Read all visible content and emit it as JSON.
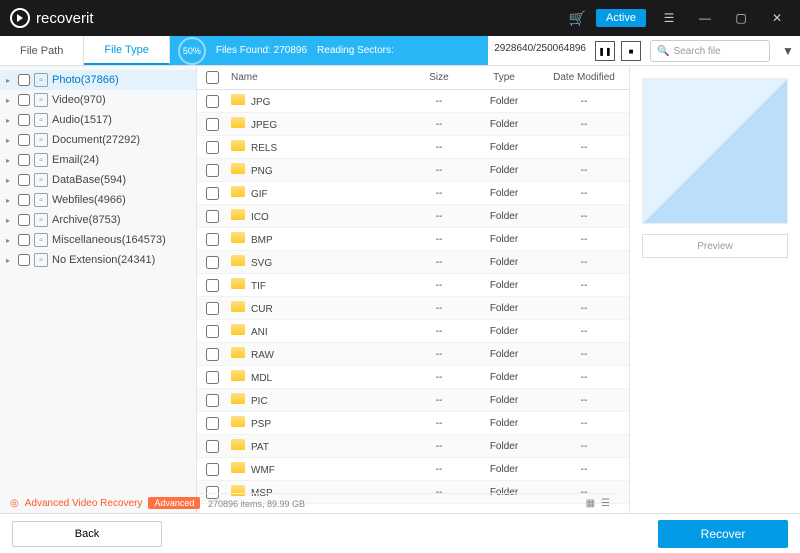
{
  "app": {
    "name": "recoverit",
    "active_btn": "Active"
  },
  "tabs": {
    "path": "File Path",
    "type": "File Type"
  },
  "scan": {
    "percent": "50%",
    "found_label": "Files Found:",
    "found_count": "270896",
    "reading_label": "Reading Sectors:",
    "sectors": "2928640/250064896"
  },
  "search": {
    "placeholder": "Search file"
  },
  "sidebar": [
    {
      "label": "Photo(37866)",
      "sel": true
    },
    {
      "label": "Video(970)"
    },
    {
      "label": "Audio(1517)"
    },
    {
      "label": "Document(27292)"
    },
    {
      "label": "Email(24)"
    },
    {
      "label": "DataBase(594)"
    },
    {
      "label": "Webfiles(4966)"
    },
    {
      "label": "Archive(8753)"
    },
    {
      "label": "Miscellaneous(164573)"
    },
    {
      "label": "No Extension(24341)"
    }
  ],
  "columns": {
    "name": "Name",
    "size": "Size",
    "type": "Type",
    "date": "Date Modified"
  },
  "rows": [
    {
      "name": "JPG",
      "size": "--",
      "type": "Folder",
      "date": "--"
    },
    {
      "name": "JPEG",
      "size": "--",
      "type": "Folder",
      "date": "--"
    },
    {
      "name": "RELS",
      "size": "--",
      "type": "Folder",
      "date": "--"
    },
    {
      "name": "PNG",
      "size": "--",
      "type": "Folder",
      "date": "--"
    },
    {
      "name": "GIF",
      "size": "--",
      "type": "Folder",
      "date": "--"
    },
    {
      "name": "ICO",
      "size": "--",
      "type": "Folder",
      "date": "--"
    },
    {
      "name": "BMP",
      "size": "--",
      "type": "Folder",
      "date": "--"
    },
    {
      "name": "SVG",
      "size": "--",
      "type": "Folder",
      "date": "--"
    },
    {
      "name": "TIF",
      "size": "--",
      "type": "Folder",
      "date": "--"
    },
    {
      "name": "CUR",
      "size": "--",
      "type": "Folder",
      "date": "--"
    },
    {
      "name": "ANI",
      "size": "--",
      "type": "Folder",
      "date": "--"
    },
    {
      "name": "RAW",
      "size": "--",
      "type": "Folder",
      "date": "--"
    },
    {
      "name": "MDL",
      "size": "--",
      "type": "Folder",
      "date": "--"
    },
    {
      "name": "PIC",
      "size": "--",
      "type": "Folder",
      "date": "--"
    },
    {
      "name": "PSP",
      "size": "--",
      "type": "Folder",
      "date": "--"
    },
    {
      "name": "PAT",
      "size": "--",
      "type": "Folder",
      "date": "--"
    },
    {
      "name": "WMF",
      "size": "--",
      "type": "Folder",
      "date": "--"
    },
    {
      "name": "MSP",
      "size": "--",
      "type": "Folder",
      "date": "--"
    }
  ],
  "preview": {
    "btn": "Preview"
  },
  "advanced": {
    "label": "Advanced Video Recovery",
    "badge": "Advanced"
  },
  "status": {
    "text": "270896 items, 89.99  GB"
  },
  "footer": {
    "back": "Back",
    "recover": "Recover"
  }
}
